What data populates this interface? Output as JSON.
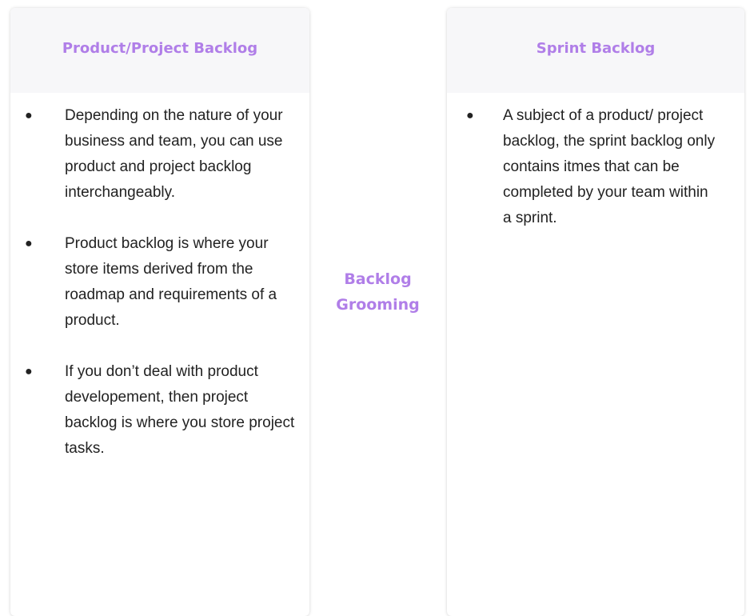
{
  "left_card": {
    "title": "Product/Project Backlog",
    "bullet_marker": "●",
    "items": [
      "Depending on the nature of your business and team, you can use product and project backlog interchangeably.",
      "Product backlog is where your store items derived from the roadmap and requirements of a product.",
      "If you don’t deal with product developement, then project backlog is where you store project tasks."
    ]
  },
  "middle": {
    "label": "Backlog Grooming"
  },
  "right_card": {
    "title": "Sprint Backlog",
    "bullet_marker": "●",
    "items": [
      "A subject of a product/ project backlog, the sprint backlog only contains itmes that can be completed by your team within a sprint."
    ]
  },
  "colors": {
    "accent": "#b07ee8",
    "header_bg": "#f7f7f9",
    "text": "#222222"
  }
}
